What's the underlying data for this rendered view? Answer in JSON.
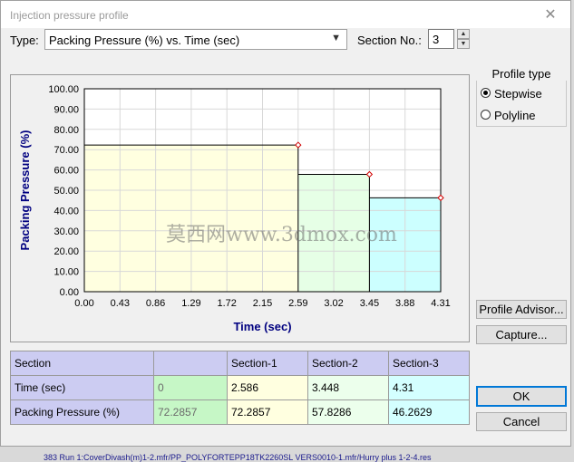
{
  "window": {
    "title": "Injection pressure profile"
  },
  "type_label": "Type:",
  "type_select": "Packing Pressure (%) vs. Time (sec)",
  "section_label": "Section No.:",
  "section_value": "3",
  "profile_type": {
    "title": "Profile type",
    "stepwise": "Stepwise",
    "polyline": "Polyline",
    "selected": "Stepwise"
  },
  "buttons": {
    "profile_advisor": "Profile Advisor...",
    "capture": "Capture...",
    "ok": "OK",
    "cancel": "Cancel"
  },
  "table": {
    "header": [
      "Section",
      "",
      "Section-1",
      "Section-2",
      "Section-3"
    ],
    "rows": [
      {
        "label": "Time (sec)",
        "values": [
          "0",
          "2.586",
          "3.448",
          "4.31"
        ]
      },
      {
        "label": "Packing Pressure (%)",
        "values": [
          "72.2857",
          "72.2857",
          "57.8286",
          "46.2629"
        ]
      }
    ]
  },
  "watermark": "莫西网www.3dmox.com",
  "bottom_text": "383   Run 1:CoverDivash(m)1-2.mfr/PP_POLYFORTEPP18TK2260SL VERS0010-1.mfr/Hurry plus 1-2-4.res",
  "chart_data": {
    "type": "area",
    "ylabel": "Packing Pressure (%)",
    "xlabel": "Time (sec)",
    "xlim": [
      0,
      4.31
    ],
    "ylim": [
      0,
      100
    ],
    "xticks": [
      "0.00",
      "0.43",
      "0.86",
      "1.29",
      "1.72",
      "2.15",
      "2.59",
      "3.02",
      "3.45",
      "3.88",
      "4.31"
    ],
    "yticks": [
      "0.00",
      "10.00",
      "20.00",
      "30.00",
      "40.00",
      "50.00",
      "60.00",
      "70.00",
      "80.00",
      "90.00",
      "100.00"
    ],
    "grid": true,
    "sections": [
      {
        "x0": 0,
        "x1": 2.586,
        "y": 72.2857,
        "color": "#ffffe0"
      },
      {
        "x0": 2.586,
        "x1": 3.448,
        "y": 57.8286,
        "color": "#e6ffe6"
      },
      {
        "x0": 3.448,
        "x1": 4.31,
        "y": 46.2629,
        "color": "#ccffff"
      }
    ],
    "marker_color": "#d00000"
  }
}
